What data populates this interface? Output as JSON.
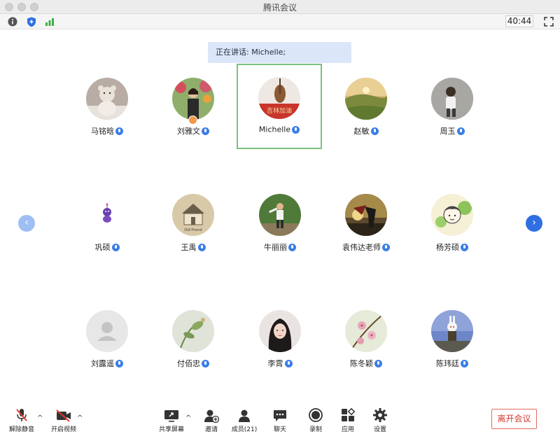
{
  "window": {
    "title": "腾讯会议"
  },
  "topbar": {
    "timer": "40:44"
  },
  "banner": {
    "speaking_text": "正在讲话: Michelle;"
  },
  "participants": [
    {
      "name": "马铭晗"
    },
    {
      "name": "刘雅文"
    },
    {
      "name": "Michelle"
    },
    {
      "name": "赵敏"
    },
    {
      "name": "周玉"
    },
    {
      "name": "巩硕"
    },
    {
      "name": "王禹"
    },
    {
      "name": "牛丽丽"
    },
    {
      "name": "袁伟达老师"
    },
    {
      "name": "杨芳硕"
    },
    {
      "name": "刘露遥"
    },
    {
      "name": "付佰忠"
    },
    {
      "name": "李霄"
    },
    {
      "name": "陈冬颖"
    },
    {
      "name": "陈玮廷"
    }
  ],
  "avatar_texts": {
    "michelle_overlay": "吉林加油",
    "wangyu_sign": "Old Friend"
  },
  "pager": {
    "prev": "‹",
    "next": "›"
  },
  "toolbar": {
    "unmute": "解除静音",
    "start_video": "开启视频",
    "share_screen": "共享屏幕",
    "invite": "邀请",
    "members": "成员(21)",
    "chat": "聊天",
    "record": "录制",
    "apps": "应用",
    "settings": "设置",
    "leave": "离开会议",
    "caret": "^"
  },
  "colors": {
    "accent": "#2f6fe1",
    "speaker_border": "#7ac27f",
    "leave": "#d3392f",
    "banner_bg": "#dbe7f9"
  }
}
